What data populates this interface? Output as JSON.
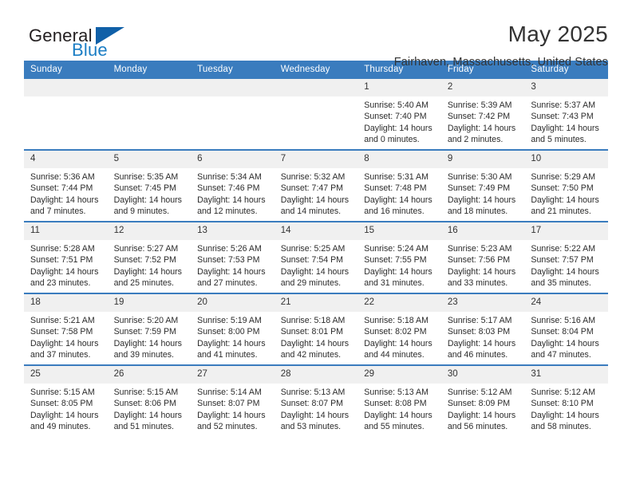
{
  "brand": {
    "name_top": "General",
    "name_bottom": "Blue",
    "accent_color": "#1060a8",
    "blue_text_color": "#1a7dc4"
  },
  "header": {
    "month_title": "May 2025",
    "location": "Fairhaven, Massachusetts, United States"
  },
  "theme": {
    "header_row_bg": "#3a7cbe",
    "daynum_bg": "#f0f0f0",
    "page_bg": "#ffffff"
  },
  "weekday_headers": [
    "Sunday",
    "Monday",
    "Tuesday",
    "Wednesday",
    "Thursday",
    "Friday",
    "Saturday"
  ],
  "weeks": [
    [
      {
        "day": "",
        "sunrise": "",
        "sunset": "",
        "daylight_line1": "",
        "daylight_line2": "",
        "empty": true
      },
      {
        "day": "",
        "sunrise": "",
        "sunset": "",
        "daylight_line1": "",
        "daylight_line2": "",
        "empty": true
      },
      {
        "day": "",
        "sunrise": "",
        "sunset": "",
        "daylight_line1": "",
        "daylight_line2": "",
        "empty": true
      },
      {
        "day": "",
        "sunrise": "",
        "sunset": "",
        "daylight_line1": "",
        "daylight_line2": "",
        "empty": true
      },
      {
        "day": "1",
        "sunrise": "Sunrise: 5:40 AM",
        "sunset": "Sunset: 7:40 PM",
        "daylight_line1": "Daylight: 14 hours",
        "daylight_line2": "and 0 minutes."
      },
      {
        "day": "2",
        "sunrise": "Sunrise: 5:39 AM",
        "sunset": "Sunset: 7:42 PM",
        "daylight_line1": "Daylight: 14 hours",
        "daylight_line2": "and 2 minutes."
      },
      {
        "day": "3",
        "sunrise": "Sunrise: 5:37 AM",
        "sunset": "Sunset: 7:43 PM",
        "daylight_line1": "Daylight: 14 hours",
        "daylight_line2": "and 5 minutes."
      }
    ],
    [
      {
        "day": "4",
        "sunrise": "Sunrise: 5:36 AM",
        "sunset": "Sunset: 7:44 PM",
        "daylight_line1": "Daylight: 14 hours",
        "daylight_line2": "and 7 minutes."
      },
      {
        "day": "5",
        "sunrise": "Sunrise: 5:35 AM",
        "sunset": "Sunset: 7:45 PM",
        "daylight_line1": "Daylight: 14 hours",
        "daylight_line2": "and 9 minutes."
      },
      {
        "day": "6",
        "sunrise": "Sunrise: 5:34 AM",
        "sunset": "Sunset: 7:46 PM",
        "daylight_line1": "Daylight: 14 hours",
        "daylight_line2": "and 12 minutes."
      },
      {
        "day": "7",
        "sunrise": "Sunrise: 5:32 AM",
        "sunset": "Sunset: 7:47 PM",
        "daylight_line1": "Daylight: 14 hours",
        "daylight_line2": "and 14 minutes."
      },
      {
        "day": "8",
        "sunrise": "Sunrise: 5:31 AM",
        "sunset": "Sunset: 7:48 PM",
        "daylight_line1": "Daylight: 14 hours",
        "daylight_line2": "and 16 minutes."
      },
      {
        "day": "9",
        "sunrise": "Sunrise: 5:30 AM",
        "sunset": "Sunset: 7:49 PM",
        "daylight_line1": "Daylight: 14 hours",
        "daylight_line2": "and 18 minutes."
      },
      {
        "day": "10",
        "sunrise": "Sunrise: 5:29 AM",
        "sunset": "Sunset: 7:50 PM",
        "daylight_line1": "Daylight: 14 hours",
        "daylight_line2": "and 21 minutes."
      }
    ],
    [
      {
        "day": "11",
        "sunrise": "Sunrise: 5:28 AM",
        "sunset": "Sunset: 7:51 PM",
        "daylight_line1": "Daylight: 14 hours",
        "daylight_line2": "and 23 minutes."
      },
      {
        "day": "12",
        "sunrise": "Sunrise: 5:27 AM",
        "sunset": "Sunset: 7:52 PM",
        "daylight_line1": "Daylight: 14 hours",
        "daylight_line2": "and 25 minutes."
      },
      {
        "day": "13",
        "sunrise": "Sunrise: 5:26 AM",
        "sunset": "Sunset: 7:53 PM",
        "daylight_line1": "Daylight: 14 hours",
        "daylight_line2": "and 27 minutes."
      },
      {
        "day": "14",
        "sunrise": "Sunrise: 5:25 AM",
        "sunset": "Sunset: 7:54 PM",
        "daylight_line1": "Daylight: 14 hours",
        "daylight_line2": "and 29 minutes."
      },
      {
        "day": "15",
        "sunrise": "Sunrise: 5:24 AM",
        "sunset": "Sunset: 7:55 PM",
        "daylight_line1": "Daylight: 14 hours",
        "daylight_line2": "and 31 minutes."
      },
      {
        "day": "16",
        "sunrise": "Sunrise: 5:23 AM",
        "sunset": "Sunset: 7:56 PM",
        "daylight_line1": "Daylight: 14 hours",
        "daylight_line2": "and 33 minutes."
      },
      {
        "day": "17",
        "sunrise": "Sunrise: 5:22 AM",
        "sunset": "Sunset: 7:57 PM",
        "daylight_line1": "Daylight: 14 hours",
        "daylight_line2": "and 35 minutes."
      }
    ],
    [
      {
        "day": "18",
        "sunrise": "Sunrise: 5:21 AM",
        "sunset": "Sunset: 7:58 PM",
        "daylight_line1": "Daylight: 14 hours",
        "daylight_line2": "and 37 minutes."
      },
      {
        "day": "19",
        "sunrise": "Sunrise: 5:20 AM",
        "sunset": "Sunset: 7:59 PM",
        "daylight_line1": "Daylight: 14 hours",
        "daylight_line2": "and 39 minutes."
      },
      {
        "day": "20",
        "sunrise": "Sunrise: 5:19 AM",
        "sunset": "Sunset: 8:00 PM",
        "daylight_line1": "Daylight: 14 hours",
        "daylight_line2": "and 41 minutes."
      },
      {
        "day": "21",
        "sunrise": "Sunrise: 5:18 AM",
        "sunset": "Sunset: 8:01 PM",
        "daylight_line1": "Daylight: 14 hours",
        "daylight_line2": "and 42 minutes."
      },
      {
        "day": "22",
        "sunrise": "Sunrise: 5:18 AM",
        "sunset": "Sunset: 8:02 PM",
        "daylight_line1": "Daylight: 14 hours",
        "daylight_line2": "and 44 minutes."
      },
      {
        "day": "23",
        "sunrise": "Sunrise: 5:17 AM",
        "sunset": "Sunset: 8:03 PM",
        "daylight_line1": "Daylight: 14 hours",
        "daylight_line2": "and 46 minutes."
      },
      {
        "day": "24",
        "sunrise": "Sunrise: 5:16 AM",
        "sunset": "Sunset: 8:04 PM",
        "daylight_line1": "Daylight: 14 hours",
        "daylight_line2": "and 47 minutes."
      }
    ],
    [
      {
        "day": "25",
        "sunrise": "Sunrise: 5:15 AM",
        "sunset": "Sunset: 8:05 PM",
        "daylight_line1": "Daylight: 14 hours",
        "daylight_line2": "and 49 minutes."
      },
      {
        "day": "26",
        "sunrise": "Sunrise: 5:15 AM",
        "sunset": "Sunset: 8:06 PM",
        "daylight_line1": "Daylight: 14 hours",
        "daylight_line2": "and 51 minutes."
      },
      {
        "day": "27",
        "sunrise": "Sunrise: 5:14 AM",
        "sunset": "Sunset: 8:07 PM",
        "daylight_line1": "Daylight: 14 hours",
        "daylight_line2": "and 52 minutes."
      },
      {
        "day": "28",
        "sunrise": "Sunrise: 5:13 AM",
        "sunset": "Sunset: 8:07 PM",
        "daylight_line1": "Daylight: 14 hours",
        "daylight_line2": "and 53 minutes."
      },
      {
        "day": "29",
        "sunrise": "Sunrise: 5:13 AM",
        "sunset": "Sunset: 8:08 PM",
        "daylight_line1": "Daylight: 14 hours",
        "daylight_line2": "and 55 minutes."
      },
      {
        "day": "30",
        "sunrise": "Sunrise: 5:12 AM",
        "sunset": "Sunset: 8:09 PM",
        "daylight_line1": "Daylight: 14 hours",
        "daylight_line2": "and 56 minutes."
      },
      {
        "day": "31",
        "sunrise": "Sunrise: 5:12 AM",
        "sunset": "Sunset: 8:10 PM",
        "daylight_line1": "Daylight: 14 hours",
        "daylight_line2": "and 58 minutes."
      }
    ]
  ]
}
